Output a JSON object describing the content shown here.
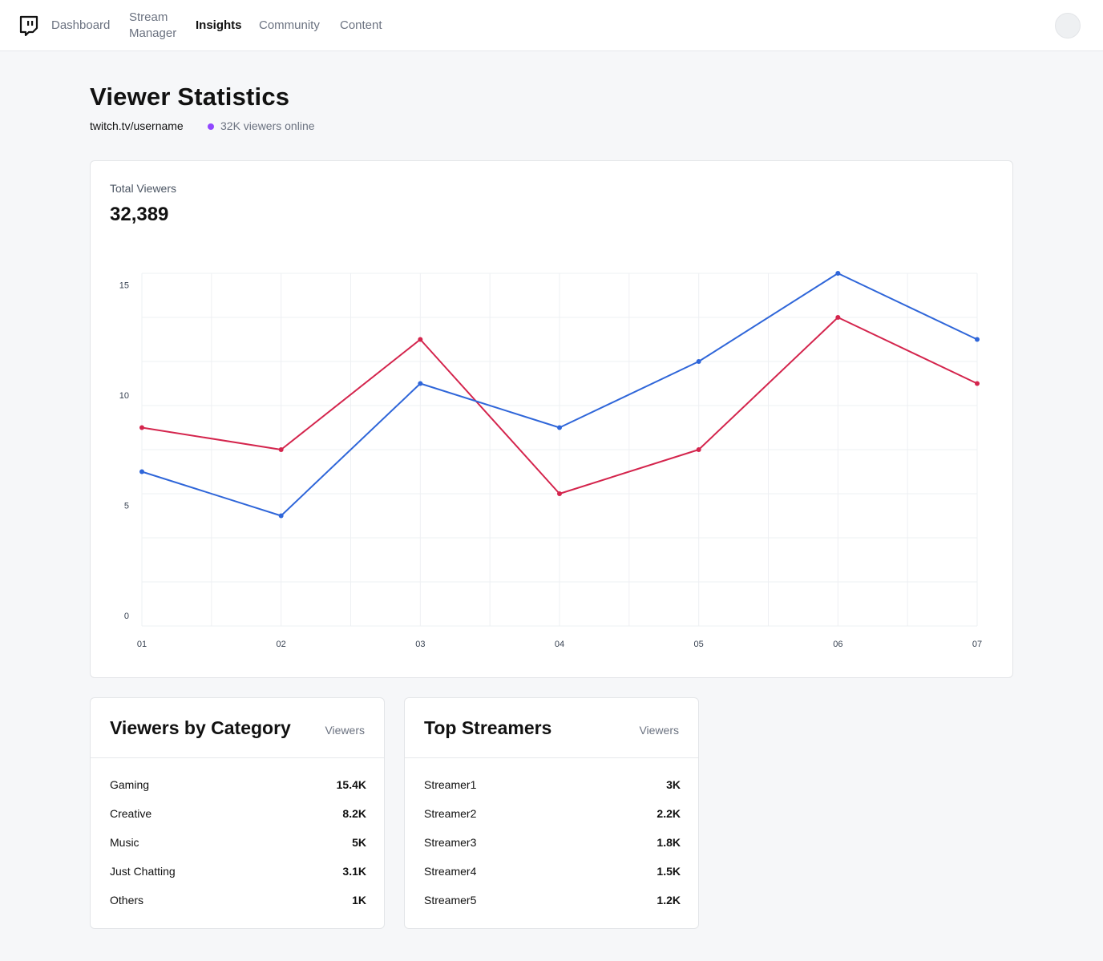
{
  "nav": {
    "items": [
      "Dashboard",
      "Stream\nManager",
      "Insights",
      "Community",
      "Content"
    ],
    "active": "Insights"
  },
  "header": {
    "title": "Viewer Statistics",
    "channel": "twitch.tv/username",
    "online": "32K viewers online",
    "online_dot_color": "#9147ff"
  },
  "total": {
    "label": "Total Viewers",
    "value": "32,389"
  },
  "chart_data": {
    "type": "line",
    "x": [
      "01",
      "02",
      "03",
      "04",
      "05",
      "06",
      "07"
    ],
    "yticks": [
      0,
      5,
      10,
      15
    ],
    "ylim": [
      0,
      16
    ],
    "grid": true,
    "series": [
      {
        "color": "#2f66d9",
        "values": [
          7,
          5,
          11,
          9,
          12,
          16,
          13
        ]
      },
      {
        "color": "#d4254d",
        "values": [
          9,
          8,
          13,
          6,
          8,
          14,
          11
        ]
      }
    ]
  },
  "categories": {
    "title": "Viewers by Category",
    "column": "Viewers",
    "rows": [
      {
        "label": "Gaming",
        "value": "15.4K"
      },
      {
        "label": "Creative",
        "value": "8.2K"
      },
      {
        "label": "Music",
        "value": "5K"
      },
      {
        "label": "Just Chatting",
        "value": "3.1K"
      },
      {
        "label": "Others",
        "value": "1K"
      }
    ]
  },
  "streamers": {
    "title": "Top Streamers",
    "column": "Viewers",
    "rows": [
      {
        "label": "Streamer1",
        "value": "3K"
      },
      {
        "label": "Streamer2",
        "value": "2.2K"
      },
      {
        "label": "Streamer3",
        "value": "1.8K"
      },
      {
        "label": "Streamer4",
        "value": "1.5K"
      },
      {
        "label": "Streamer5",
        "value": "1.2K"
      }
    ]
  }
}
